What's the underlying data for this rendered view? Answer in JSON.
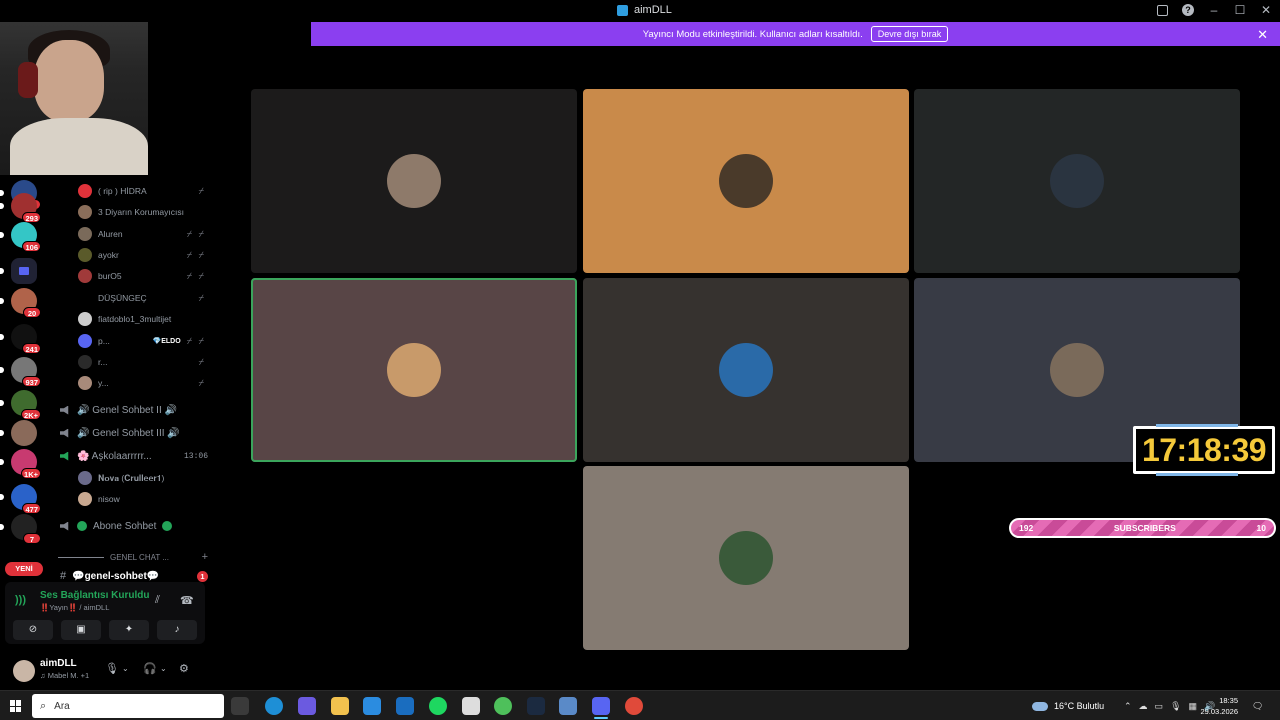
{
  "app": {
    "title": "aimDLL",
    "help_icon": "help-icon"
  },
  "banner": {
    "message": "Yayıncı Modu etkinleştirildi. Kullanıcı adları kısaltıldı.",
    "button": "Devre dışı bırak"
  },
  "servers": [
    {
      "badge": "80",
      "color": "#2a4a8a"
    },
    {
      "badge": "293",
      "color": "#a03030"
    },
    {
      "badge": "106",
      "color": "#34c6c6"
    },
    {
      "badge": "",
      "color": "#202234"
    },
    {
      "badge": "20",
      "color": "#b0634a"
    },
    {
      "badge": "241",
      "color": "#111111"
    },
    {
      "badge": "937",
      "color": "#777777"
    },
    {
      "badge": "2K+",
      "color": "#3f6b2e"
    },
    {
      "badge": "",
      "color": "#8a6a5a"
    },
    {
      "badge": "1K+",
      "color": "#c83a70"
    },
    {
      "badge": "477",
      "color": "#2a62c9"
    },
    {
      "badge": "7",
      "color": "#222222"
    }
  ],
  "new_label": "YENİ",
  "members": [
    {
      "name": "( rip ) HİDRA",
      "color": "#e0323a",
      "status": "⌿"
    },
    {
      "name": "3 Diyarın Korumayıcısı",
      "color": "#8a6e5a",
      "status": ""
    },
    {
      "name": "Aluren",
      "color": "#7a6a5a",
      "status": "⌿ ⌿"
    },
    {
      "name": "ayokr",
      "color": "#5a5a2a",
      "status": "⌿ ⌿"
    },
    {
      "name": "burO5",
      "color": "#a03a3a",
      "status": "⌿ ⌿"
    },
    {
      "name": "DÜŞÜNGEÇ",
      "color": "#000000",
      "status": "⌿"
    },
    {
      "name": "fiatdoblo1_3multijet",
      "color": "#cccccc",
      "status": ""
    },
    {
      "name": "p...",
      "tag": "💎ELDO",
      "color": "#5865f2",
      "status": "⌿ ⌿"
    },
    {
      "name": "r...",
      "color": "#2a2a2a",
      "status": "⌿"
    },
    {
      "name": "y...",
      "color": "#a88a7a",
      "status": "⌿"
    }
  ],
  "voice_channels": [
    {
      "label": "🔊 Genel Sohbet II 🔊",
      "active": false
    },
    {
      "label": "🔊 Genel Sohbet III 🔊",
      "active": false
    },
    {
      "label": "🌸 Aşkolaarrrrr...",
      "active": true,
      "time": "13:06"
    }
  ],
  "voice_members": [
    {
      "name": "𝐍𝐨𝐯𝐚 (𝐂𝐫𝐮𝐥𝐥𝐞𝐞𝐫𝟏)",
      "color": "#6a6a8a"
    },
    {
      "name": "nisow",
      "color": "#c8a890"
    }
  ],
  "abone": {
    "label": "Abone Sohbet"
  },
  "category": "GENEL CHAT ...",
  "text_channel": {
    "label": "💬genel-sohbet💬",
    "unread": "1"
  },
  "voice_panel": {
    "title": "Ses Bağlantısı Kuruldu",
    "subtitle": "‼️Yayın‼️ / aimDLL"
  },
  "user": {
    "name": "aimDLL",
    "activity": "♫ Mabel M. +1"
  },
  "overlay": {
    "clock": "17:18:39",
    "subs_left": "192",
    "subs_label": "SUBSCRIBERS",
    "subs_right": "10"
  },
  "tiles": [
    {
      "bg": "#1c1b1b",
      "avatar": "#8e7a6a",
      "speaking": false
    },
    {
      "bg": "#c98a4a",
      "avatar": "#4a3a2a",
      "speaking": false
    },
    {
      "bg": "#232626",
      "avatar": "#2a3440",
      "speaking": false
    },
    {
      "bg": "#584546",
      "avatar": "#c89a6a",
      "speaking": true
    },
    {
      "bg": "#36322f",
      "avatar": "#2a6aa8",
      "speaking": false
    },
    {
      "bg": "#383b45",
      "avatar": "#7a6a5a",
      "speaking": false
    },
    {
      "bg": "#857b72",
      "avatar": "#3a5a3a",
      "speaking": false
    }
  ],
  "taskbar": {
    "search_placeholder": "Ara",
    "weather": "16°C  Bulutlu",
    "time": "18:35",
    "date": "29.03.2026",
    "apps": [
      {
        "name": "task-view-icon",
        "color": "#3a3a3a"
      },
      {
        "name": "edge-icon",
        "color": "#1e8fd6"
      },
      {
        "name": "copilot-icon",
        "color": "#6b5ae0"
      },
      {
        "name": "explorer-icon",
        "color": "#f2c14e"
      },
      {
        "name": "store-icon",
        "color": "#2b8ce0"
      },
      {
        "name": "mail-icon",
        "color": "#1a6dbf"
      },
      {
        "name": "spotify-icon",
        "color": "#1ed760"
      },
      {
        "name": "app-icon",
        "color": "#dddddd"
      },
      {
        "name": "xbox-icon",
        "color": "#4ec05b"
      },
      {
        "name": "steam-icon",
        "color": "#1b2a40"
      },
      {
        "name": "app2-icon",
        "color": "#5a8ac8"
      },
      {
        "name": "discord-icon",
        "color": "#5865f2"
      },
      {
        "name": "chrome-icon",
        "color": "#e04a3a"
      }
    ]
  }
}
